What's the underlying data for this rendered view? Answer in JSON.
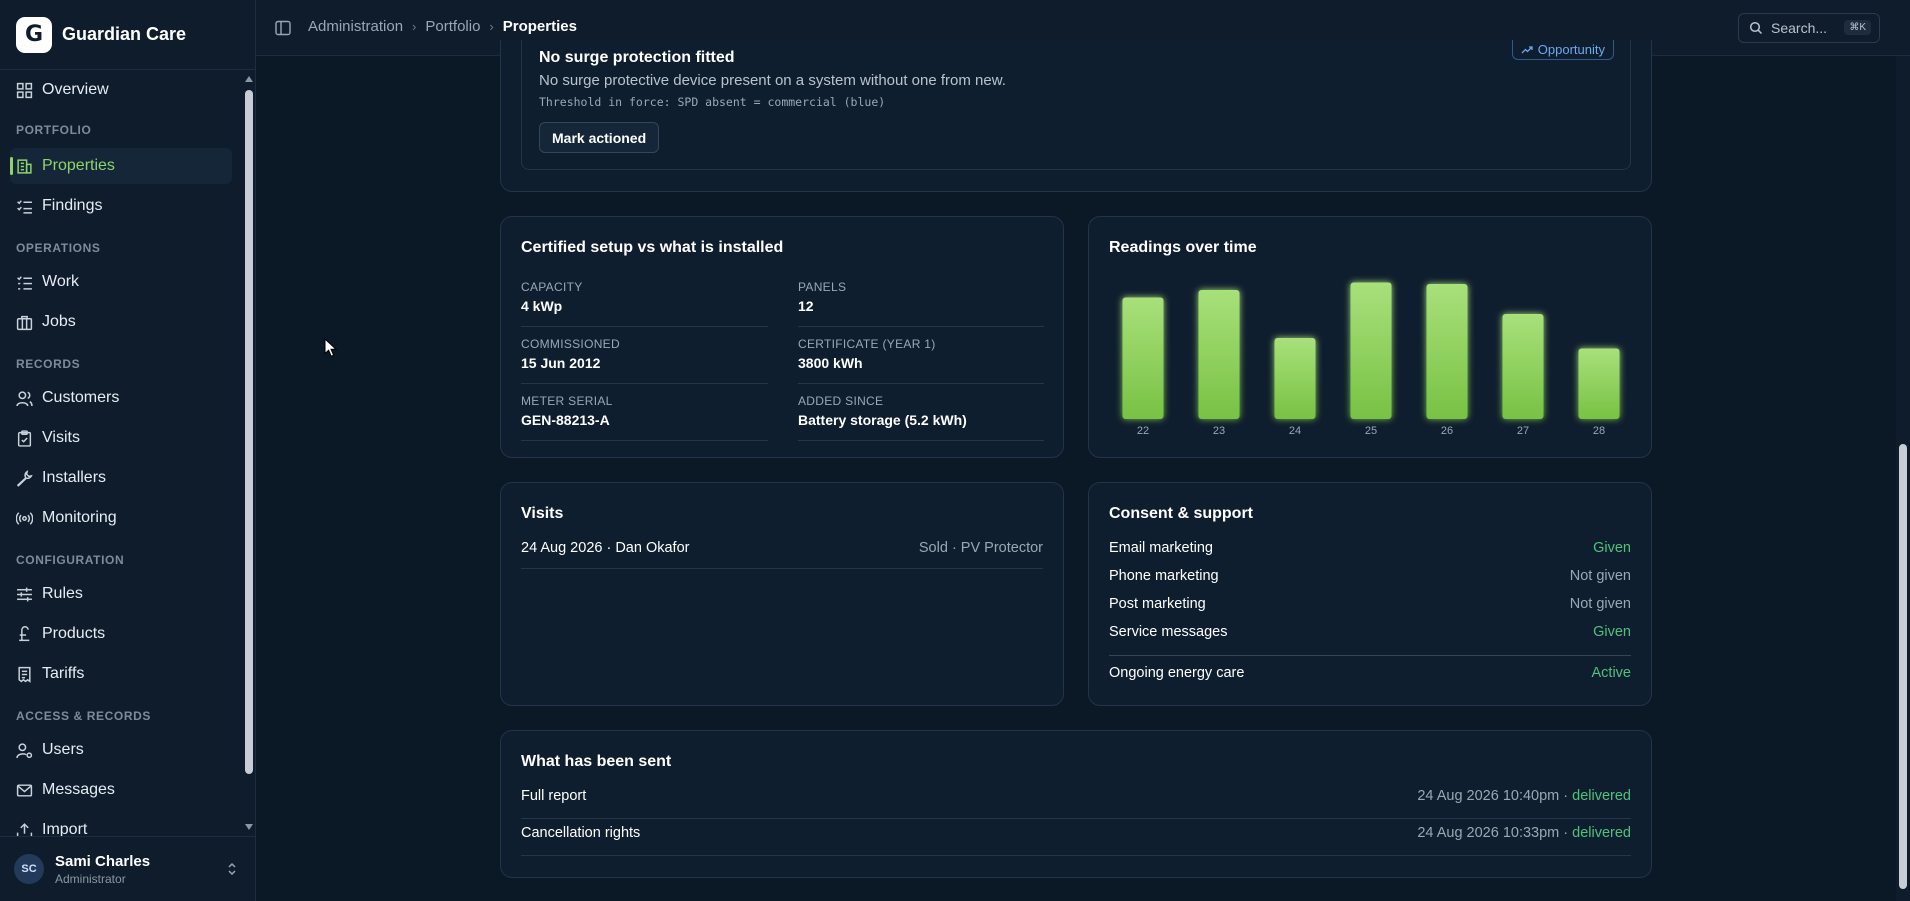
{
  "app": {
    "name": "Guardian Care",
    "logo_letter": "G"
  },
  "sidebar": {
    "items": [
      {
        "label": "Overview",
        "icon": "grid-icon"
      },
      {
        "section": "PORTFOLIO"
      },
      {
        "label": "Properties",
        "icon": "building-icon",
        "active": true
      },
      {
        "label": "Findings",
        "icon": "checklist-icon"
      },
      {
        "section": "OPERATIONS"
      },
      {
        "label": "Work",
        "icon": "list-icon"
      },
      {
        "label": "Jobs",
        "icon": "briefcase-icon"
      },
      {
        "section": "RECORDS"
      },
      {
        "label": "Customers",
        "icon": "users-icon"
      },
      {
        "label": "Visits",
        "icon": "clipboard-icon"
      },
      {
        "label": "Installers",
        "icon": "wrench-icon"
      },
      {
        "label": "Monitoring",
        "icon": "radio-icon"
      },
      {
        "section": "CONFIGURATION"
      },
      {
        "label": "Rules",
        "icon": "sliders-icon"
      },
      {
        "label": "Products",
        "icon": "pound-icon"
      },
      {
        "label": "Tariffs",
        "icon": "receipt-icon"
      },
      {
        "section": "ACCESS & RECORDS"
      },
      {
        "label": "Users",
        "icon": "user-gear-icon"
      },
      {
        "label": "Messages",
        "icon": "mail-icon"
      },
      {
        "label": "Import",
        "icon": "upload-icon"
      }
    ]
  },
  "user": {
    "initials": "SC",
    "name": "Sami Charles",
    "role": "Administrator"
  },
  "breadcrumb": [
    "Administration",
    "Portfolio",
    "Properties"
  ],
  "search": {
    "label": "Search...",
    "shortcut": "⌘K"
  },
  "finding": {
    "title": "No surge protection fitted",
    "description": "No surge protective device present on a system without one from new.",
    "threshold": "Threshold in force: SPD absent = commercial (blue)",
    "action_label": "Mark actioned",
    "badge": "Opportunity"
  },
  "setup": {
    "title": "Certified setup vs what is installed",
    "fields": [
      {
        "label": "CAPACITY",
        "value": "4 kWp"
      },
      {
        "label": "PANELS",
        "value": "12"
      },
      {
        "label": "COMMISSIONED",
        "value": "15 Jun 2012"
      },
      {
        "label": "CERTIFICATE (YEAR 1)",
        "value": "3800 kWh"
      },
      {
        "label": "METER SERIAL",
        "value": "GEN-88213-A"
      },
      {
        "label": "ADDED SINCE",
        "value": "Battery storage (5.2 kWh)"
      }
    ]
  },
  "readings": {
    "title": "Readings over time"
  },
  "chart_data": {
    "type": "bar",
    "title": "Readings over time",
    "categories": [
      "22",
      "23",
      "24",
      "25",
      "26",
      "27",
      "28"
    ],
    "values": [
      81,
      86,
      54,
      91,
      90,
      70,
      47
    ],
    "ylim": [
      0,
      100
    ],
    "grid": false,
    "bar_color": "#8fd46a"
  },
  "visits": {
    "title": "Visits",
    "rows": [
      {
        "left": "24 Aug 2026 · Dan Okafor",
        "right": "Sold · PV Protector"
      }
    ]
  },
  "consent": {
    "title": "Consent & support",
    "rows": [
      {
        "label": "Email marketing",
        "value": "Given"
      },
      {
        "label": "Phone marketing",
        "value": "Not given"
      },
      {
        "label": "Post marketing",
        "value": "Not given"
      },
      {
        "label": "Service messages",
        "value": "Given"
      },
      {
        "label": "Ongoing energy care",
        "value": "Active"
      }
    ]
  },
  "sent": {
    "title": "What has been sent",
    "rows": [
      {
        "label": "Full report",
        "time": "24 Aug 2026 10:40pm",
        "status": "delivered"
      },
      {
        "label": "Cancellation rights",
        "time": "24 Aug 2026 10:33pm",
        "status": "delivered"
      }
    ]
  },
  "colors": {
    "accent": "#8fd46a",
    "positive": "#4fc27a",
    "badge": "#6ea8ee"
  }
}
